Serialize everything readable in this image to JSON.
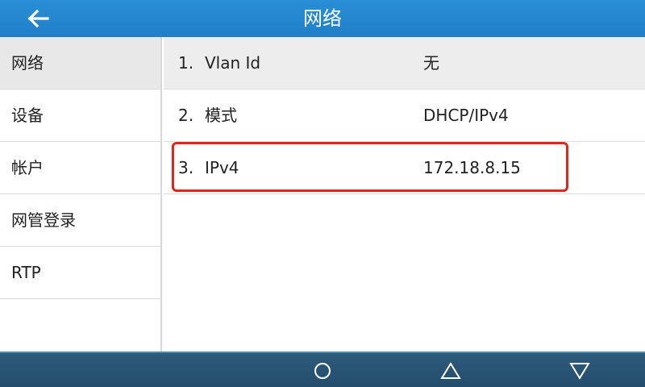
{
  "header": {
    "title": "网络",
    "back_icon": "arrow-left-icon"
  },
  "sidebar": {
    "items": [
      {
        "label": "网络",
        "active": true
      },
      {
        "label": "设备",
        "active": false
      },
      {
        "label": "帐户",
        "active": false
      },
      {
        "label": "网管登录",
        "active": false
      },
      {
        "label": "RTP",
        "active": false
      }
    ]
  },
  "main": {
    "rows": [
      {
        "number": "1.",
        "label": "Vlan Id",
        "value": "无"
      },
      {
        "number": "2.",
        "label": "模式",
        "value": "DHCP/IPv4"
      },
      {
        "number": "3.",
        "label": "IPv4",
        "value": "172.18.8.15"
      }
    ],
    "highlighted_row": 3,
    "highlight_color": "#e1251b"
  },
  "bottom_bar": {
    "buttons": [
      {
        "icon": "circle-icon"
      },
      {
        "icon": "triangle-up-icon"
      },
      {
        "icon": "triangle-down-icon"
      }
    ]
  },
  "colors": {
    "title_bar": "#2088d0",
    "bottom_bar": "#284f6e"
  }
}
